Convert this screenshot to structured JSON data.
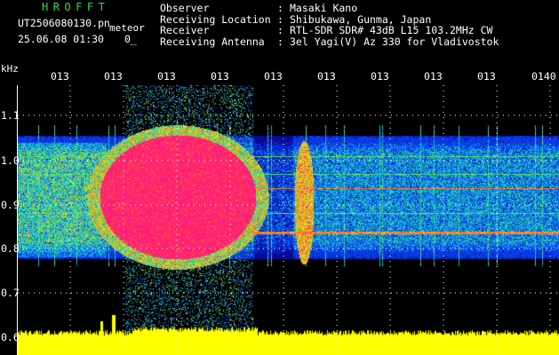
{
  "header": {
    "brand": "HROFFT",
    "file_name": "UT2506080130.pn",
    "mode_tag": "meteor",
    "datetime": "25.06.08 01:30",
    "extra": "0_"
  },
  "info": [
    {
      "label": "Observer",
      "sep": ":",
      "value": "Masaki Kano"
    },
    {
      "label": "Receiving Location",
      "sep": ":",
      "value": "Shibukawa, Gunma, Japan"
    },
    {
      "label": "Receiver",
      "sep": ":",
      "value": "RTL-SDR SDR# 43dB L15 103.2MHz CW"
    },
    {
      "label": "Receiving Antenna",
      "sep": ":",
      "value": "3el Yagi(V) Az 330 for Vladivostok"
    }
  ],
  "axis": {
    "unit": "kHz",
    "y_ticks": [
      "1.1",
      "1.0",
      "0.9",
      "0.8",
      "0.7",
      "0.6"
    ],
    "x_ticks": [
      "013",
      "013",
      "013",
      "013",
      "013",
      "013",
      "013",
      "013",
      "013",
      "0140"
    ]
  },
  "colors": {
    "text": "#ffffff",
    "brand": "#33dd44",
    "background": "#000000",
    "saturated": "#ff1f7a",
    "bar": "#ffff00",
    "grid": "#ffffff"
  }
}
